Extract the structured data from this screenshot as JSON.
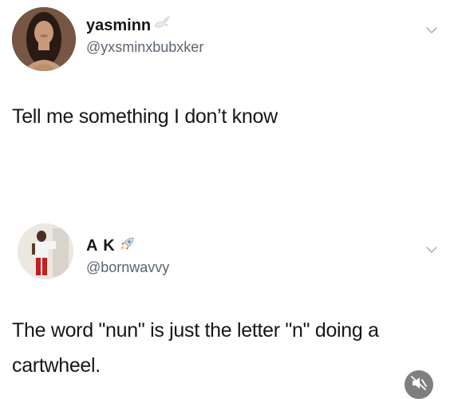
{
  "tweets": [
    {
      "display_name": "yasminn",
      "name_emoji_icon": "dove-icon",
      "handle": "@yxsminxbubxker",
      "text": "Tell me something I don’t know",
      "menu_icon": "chevron-down-icon"
    },
    {
      "display_name": "A K",
      "name_emoji_icon": "rocket-icon",
      "handle": "@bornwavvy",
      "text": "The word \"nun\" is just the letter \"n\" doing a cartwheel.",
      "menu_icon": "chevron-down-icon"
    }
  ],
  "overlay": {
    "mute_icon": "speaker-muted-icon",
    "color": "#7f7f7f"
  },
  "colors": {
    "text": "#14171a",
    "handle": "#5b6670",
    "chevron": "#aab8c2"
  }
}
